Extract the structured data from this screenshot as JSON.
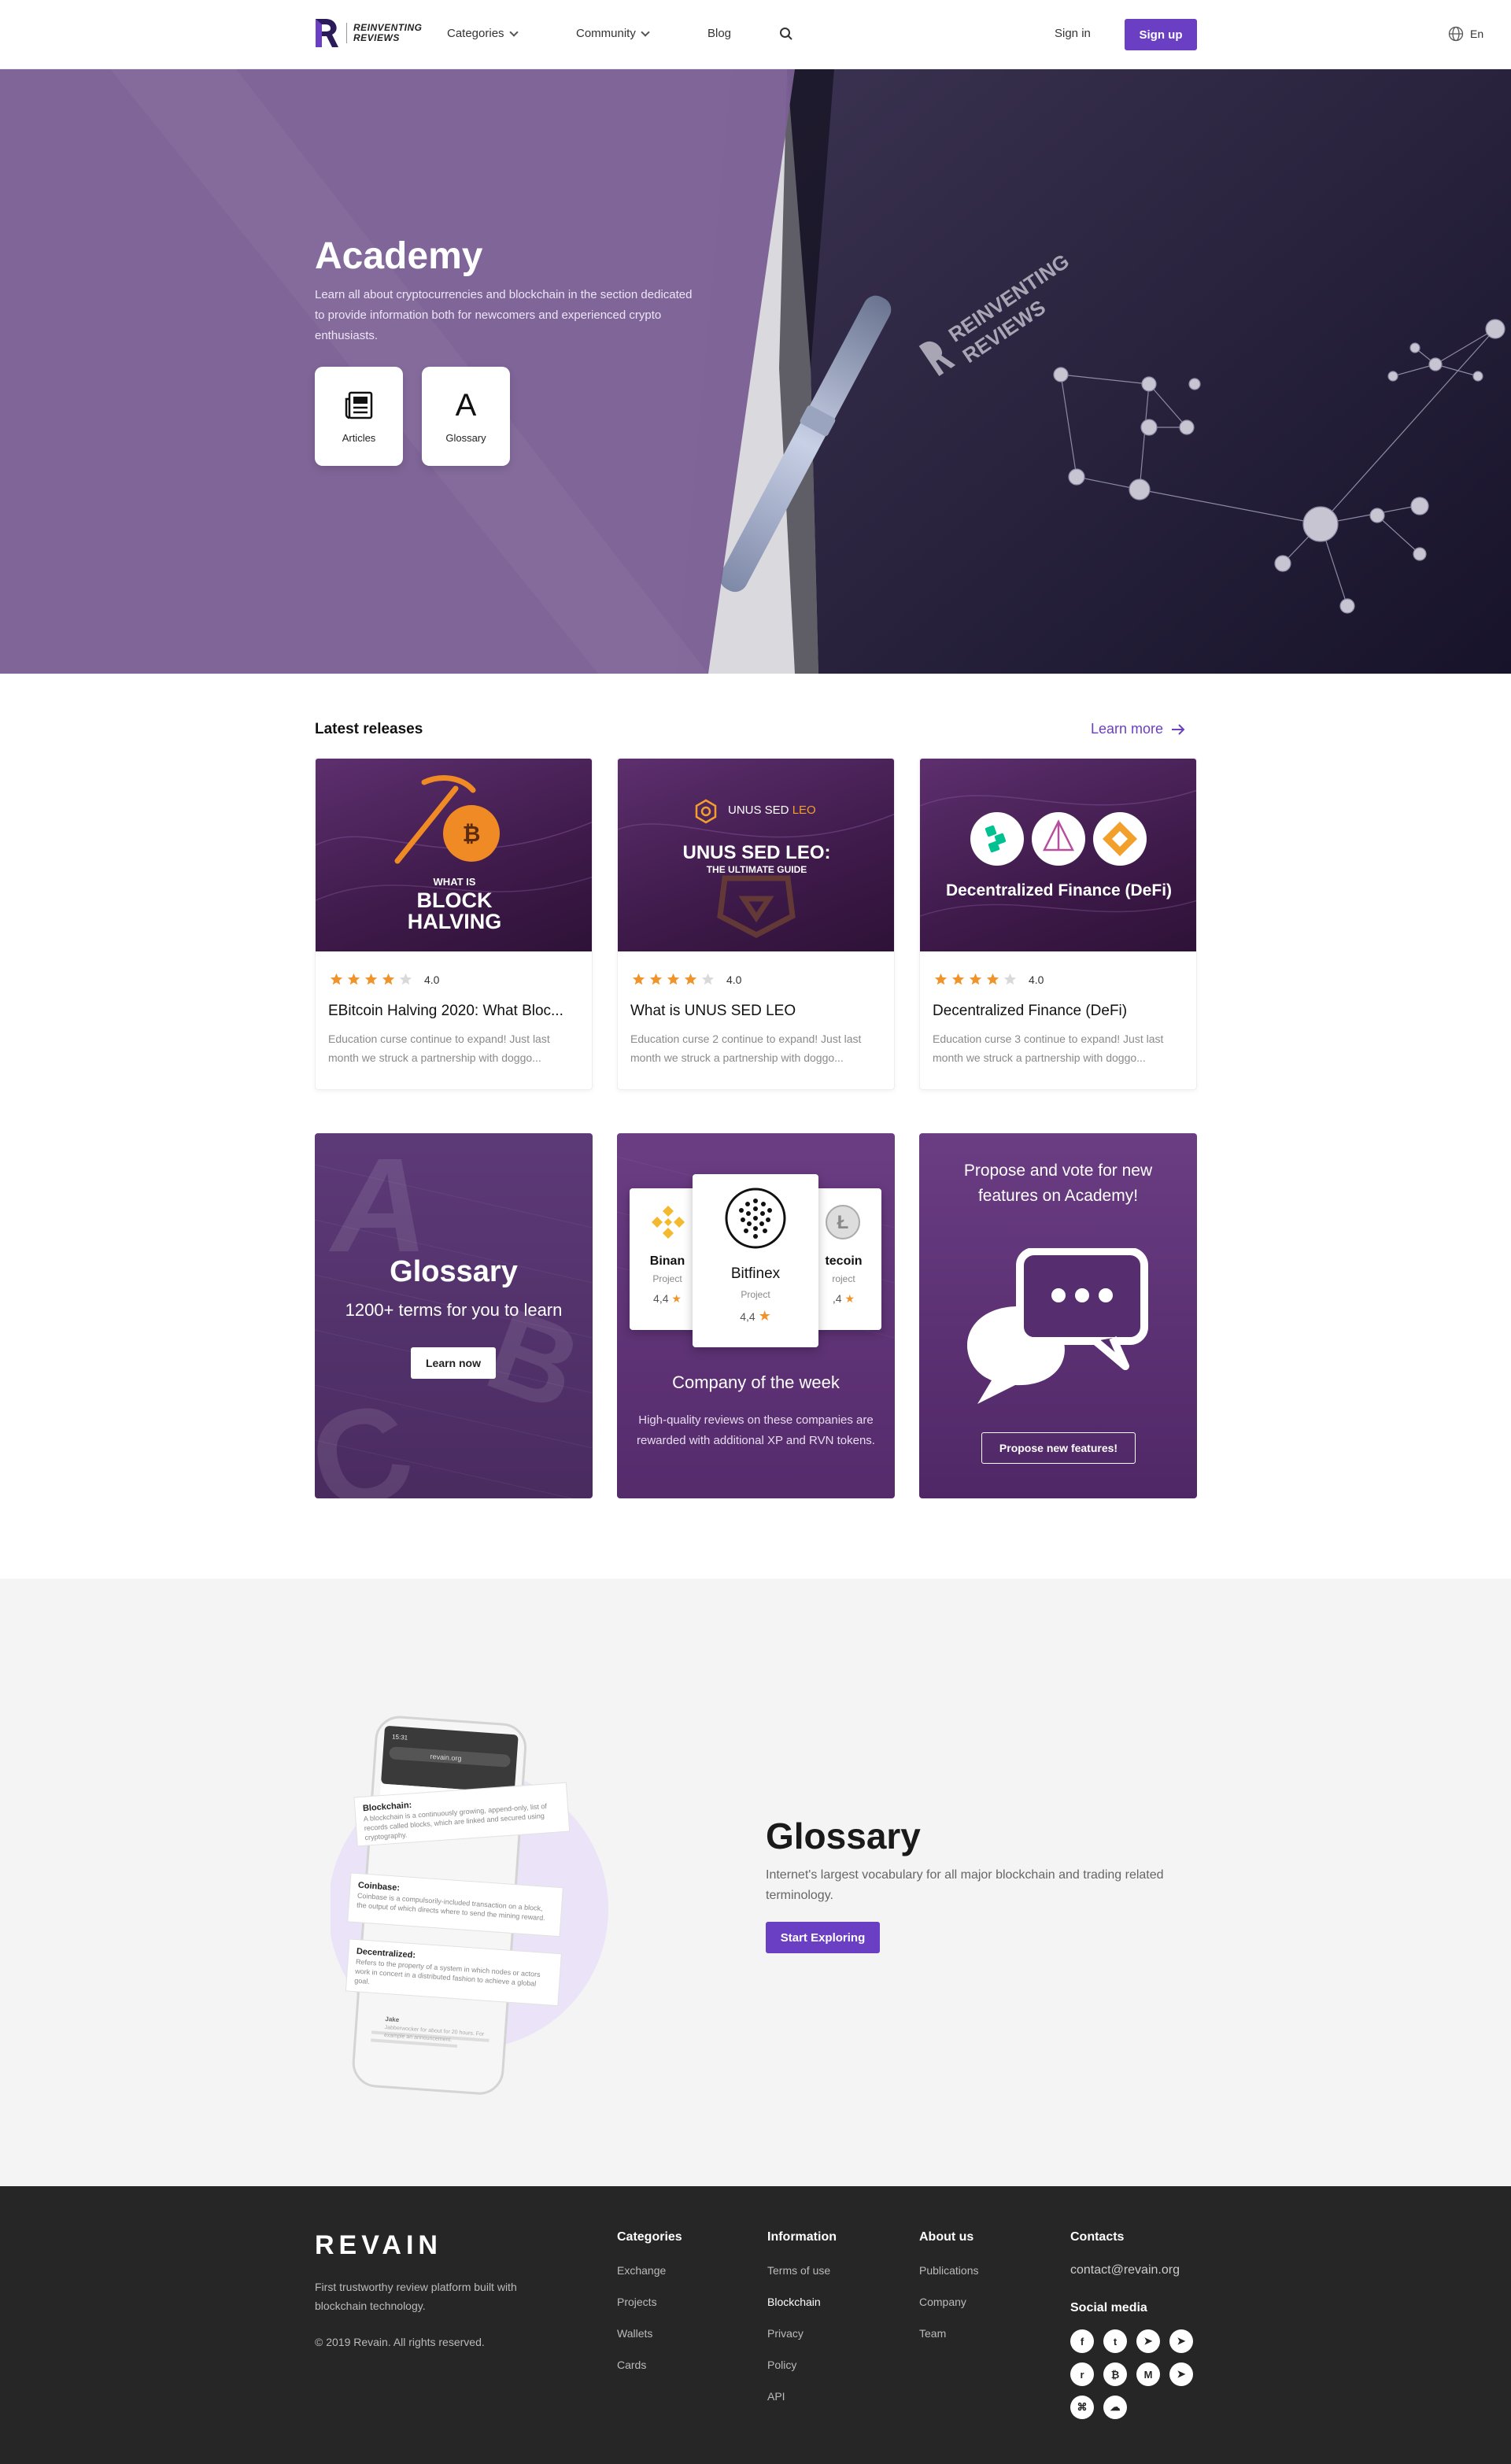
{
  "nav": {
    "logo_line1": "REINVENTING",
    "logo_line2": "REVIEWS",
    "categories": "Categories",
    "community": "Community",
    "blog": "Blog",
    "signin": "Sign in",
    "signup": "Sign up",
    "lang": "En"
  },
  "hero": {
    "title": "Academy",
    "description": "Learn all about cryptocurrencies and blockchain in the section dedicated to provide information both for newcomers and experienced crypto enthusiasts.",
    "tile_articles": "Articles",
    "tile_glossary": "Glossary",
    "tile_glossary_glyph": "A",
    "notebook_brand_1": "REINVENTING",
    "notebook_brand_2": "REVIEWS"
  },
  "latest": {
    "title": "Latest releases",
    "learn_more": "Learn more",
    "cards": [
      {
        "image_line1": "WHAT IS",
        "image_line2": "BLOCK",
        "image_line3": "HALVING",
        "rating": "4.0",
        "stars": 4,
        "title": "EBitcoin Halving 2020: What Bloc...",
        "description": "Education curse continue to expand! Just last month we struck a partnership with doggo..."
      },
      {
        "image_top": "UNUS SED",
        "image_top_accent": "LEO",
        "image_line1": "UNUS SED LEO:",
        "image_line2": "THE ULTIMATE GUIDE",
        "rating": "4.0",
        "stars": 4,
        "title": "What is UNUS SED LEO",
        "description": "Education curse 2 continue to expand! Just last month we struck a partnership with doggo..."
      },
      {
        "image_line1": "Decentralized Finance (DeFi)",
        "rating": "4.0",
        "stars": 4,
        "title": "Decentralized Finance (DeFi)",
        "description": "Education curse 3 continue to expand! Just last month we struck a partnership with doggo..."
      }
    ]
  },
  "promos": {
    "glossary": {
      "title": "Glossary",
      "subtitle": "1200+ terms for you to learn",
      "button": "Learn now",
      "deco_letters": [
        "A",
        "B",
        "C"
      ]
    },
    "company": {
      "title": "Company of the week",
      "description": "High-quality reviews on these companies are rewarded with additional XP and RVN tokens.",
      "left": {
        "name": "Binan",
        "kind": "Project",
        "rating": "4,4"
      },
      "center": {
        "name": "Bitfinex",
        "kind": "Project",
        "rating": "4,4"
      },
      "right": {
        "name": "tecoin",
        "kind": "roject",
        "rating": ",4"
      }
    },
    "propose": {
      "title": "Propose and vote for new features on Academy!",
      "button": "Propose new features!"
    }
  },
  "glossary_section": {
    "title": "Glossary",
    "description": "Internet's largest vocabulary for all major blockchain and trading related terminology.",
    "button": "Start Exploring",
    "phone_url": "revain.org",
    "phone_time": "15:31",
    "term1": "Blockchain:",
    "term1_desc": "A blockchain is a continuously growing, append-only, list of records called blocks, which are linked and secured using cryptography.",
    "term2": "Coinbase:",
    "term2_desc": "Coinbase is a compulsorily-included transaction on a block, the output of which directs where to send the mining reward.",
    "term3": "Decentralized:",
    "term3_desc": "Refers to the property of a system in which nodes or actors work in concert in a distributed fashion to achieve a global goal.",
    "term4": "Jake",
    "term4_desc": "Jabberwocker for about for 20 hours. For example an announcement."
  },
  "footer": {
    "logo": "REVAIN",
    "tagline": "First trustworthy review platform built with blockchain technology.",
    "copyright": "© 2019 Revain. All rights reserved.",
    "categories": {
      "title": "Categories",
      "links": [
        "Exchange",
        "Projects",
        "Wallets",
        "Cards"
      ]
    },
    "information": {
      "title": "Information",
      "links": [
        "Terms of use",
        "Blockchain",
        "Privacy",
        "Policy",
        "API"
      ]
    },
    "about": {
      "title": "About us",
      "links": [
        "Publications",
        "Company",
        "Team"
      ]
    },
    "contacts": {
      "title": "Contacts",
      "email": "contact@revain.org",
      "social_title": "Social media"
    },
    "social": [
      "facebook-icon",
      "twitter-icon",
      "telegram-icon",
      "telegram-icon",
      "reddit-icon",
      "bitcointalk-icon",
      "medium-icon",
      "telegram-icon",
      "github-icon",
      "wechat-icon"
    ]
  },
  "colors": {
    "accent": "#6a3fc4",
    "star": "#f0932b",
    "hero_purple": "#7a5f94",
    "footer_bg": "#262626"
  }
}
